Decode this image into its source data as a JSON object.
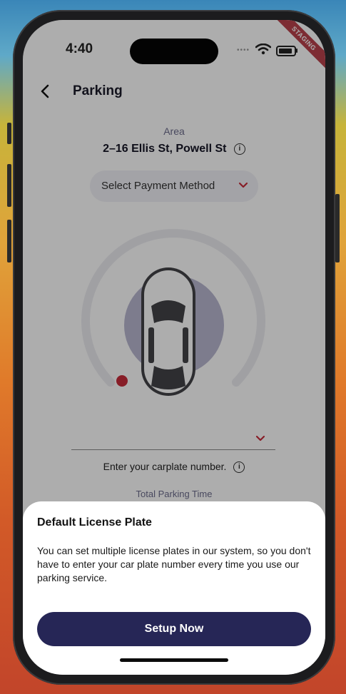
{
  "status_bar": {
    "time": "4:40",
    "signal_icon": "signal-dots-icon",
    "wifi_icon": "wifi-icon",
    "battery_icon": "battery-icon",
    "ribbon": "STAGING"
  },
  "header": {
    "back_icon": "chevron-left-icon",
    "title": "Parking"
  },
  "area": {
    "label": "Area",
    "address": "2–16 Ellis St,  Powell St",
    "info_icon": "info-icon",
    "info_glyph": "i"
  },
  "payment": {
    "label": "Select Payment Method",
    "chevron_icon": "chevron-down-icon"
  },
  "gauge": {
    "car_icon": "car-top-view-icon",
    "indicator_color": "#c72c3a"
  },
  "plate": {
    "chevron_icon": "chevron-down-icon",
    "hint": "Enter your carplate number.",
    "info_glyph": "i"
  },
  "total": {
    "label": "Total Parking Time"
  },
  "sheet": {
    "title": "Default License Plate",
    "body": "You can set multiple license plates in our system, so you don't have to enter your car plate number every time you use our parking service.",
    "button_label": "Setup Now"
  },
  "colors": {
    "primary": "#262656",
    "accent": "#c72c3a",
    "staging": "#b8424c"
  }
}
